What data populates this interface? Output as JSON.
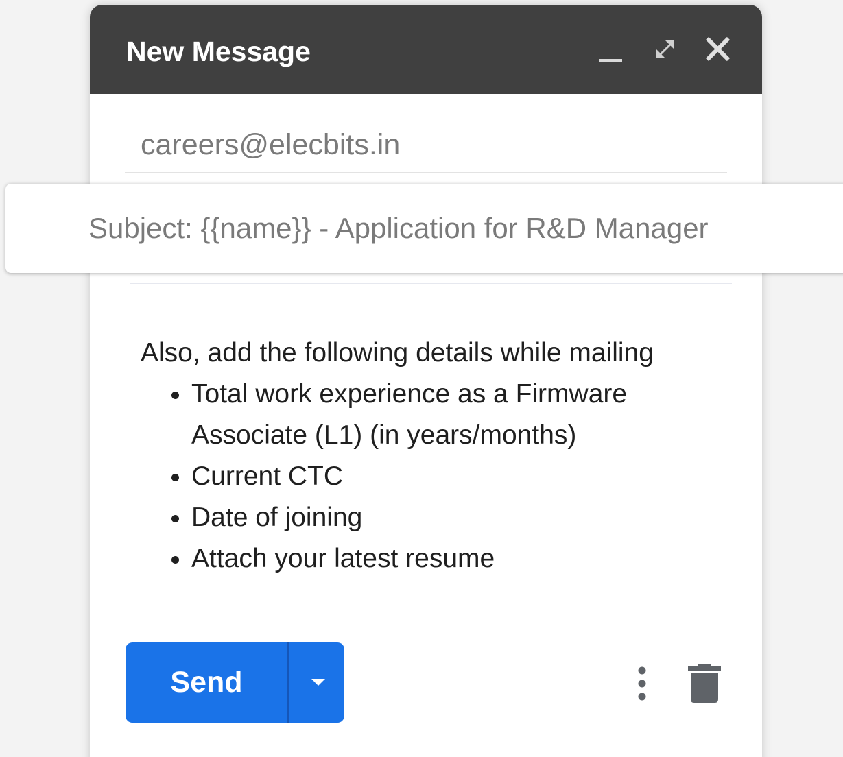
{
  "window": {
    "title": "New Message",
    "controls": [
      "minimize-icon",
      "expand-icon",
      "close-icon"
    ]
  },
  "to": {
    "value": "careers@elecbits.in"
  },
  "subject": {
    "value": "Subject: {{name}} - Application for R&D Manager"
  },
  "body": {
    "intro": "Also, add the following details while mailing",
    "items": [
      "Total work experience as a Firmware Associate (L1) (in years/months)",
      "Current CTC",
      "Date of joining",
      "Attach your latest resume"
    ]
  },
  "footer": {
    "send_label": "Send",
    "send_options_icon": "caret-down-icon",
    "more_icon": "more-vertical-icon",
    "discard_icon": "trash-icon"
  },
  "colors": {
    "titlebar": "#404040",
    "send_button": "#1a73e8",
    "muted_text": "#7a7a7a"
  }
}
